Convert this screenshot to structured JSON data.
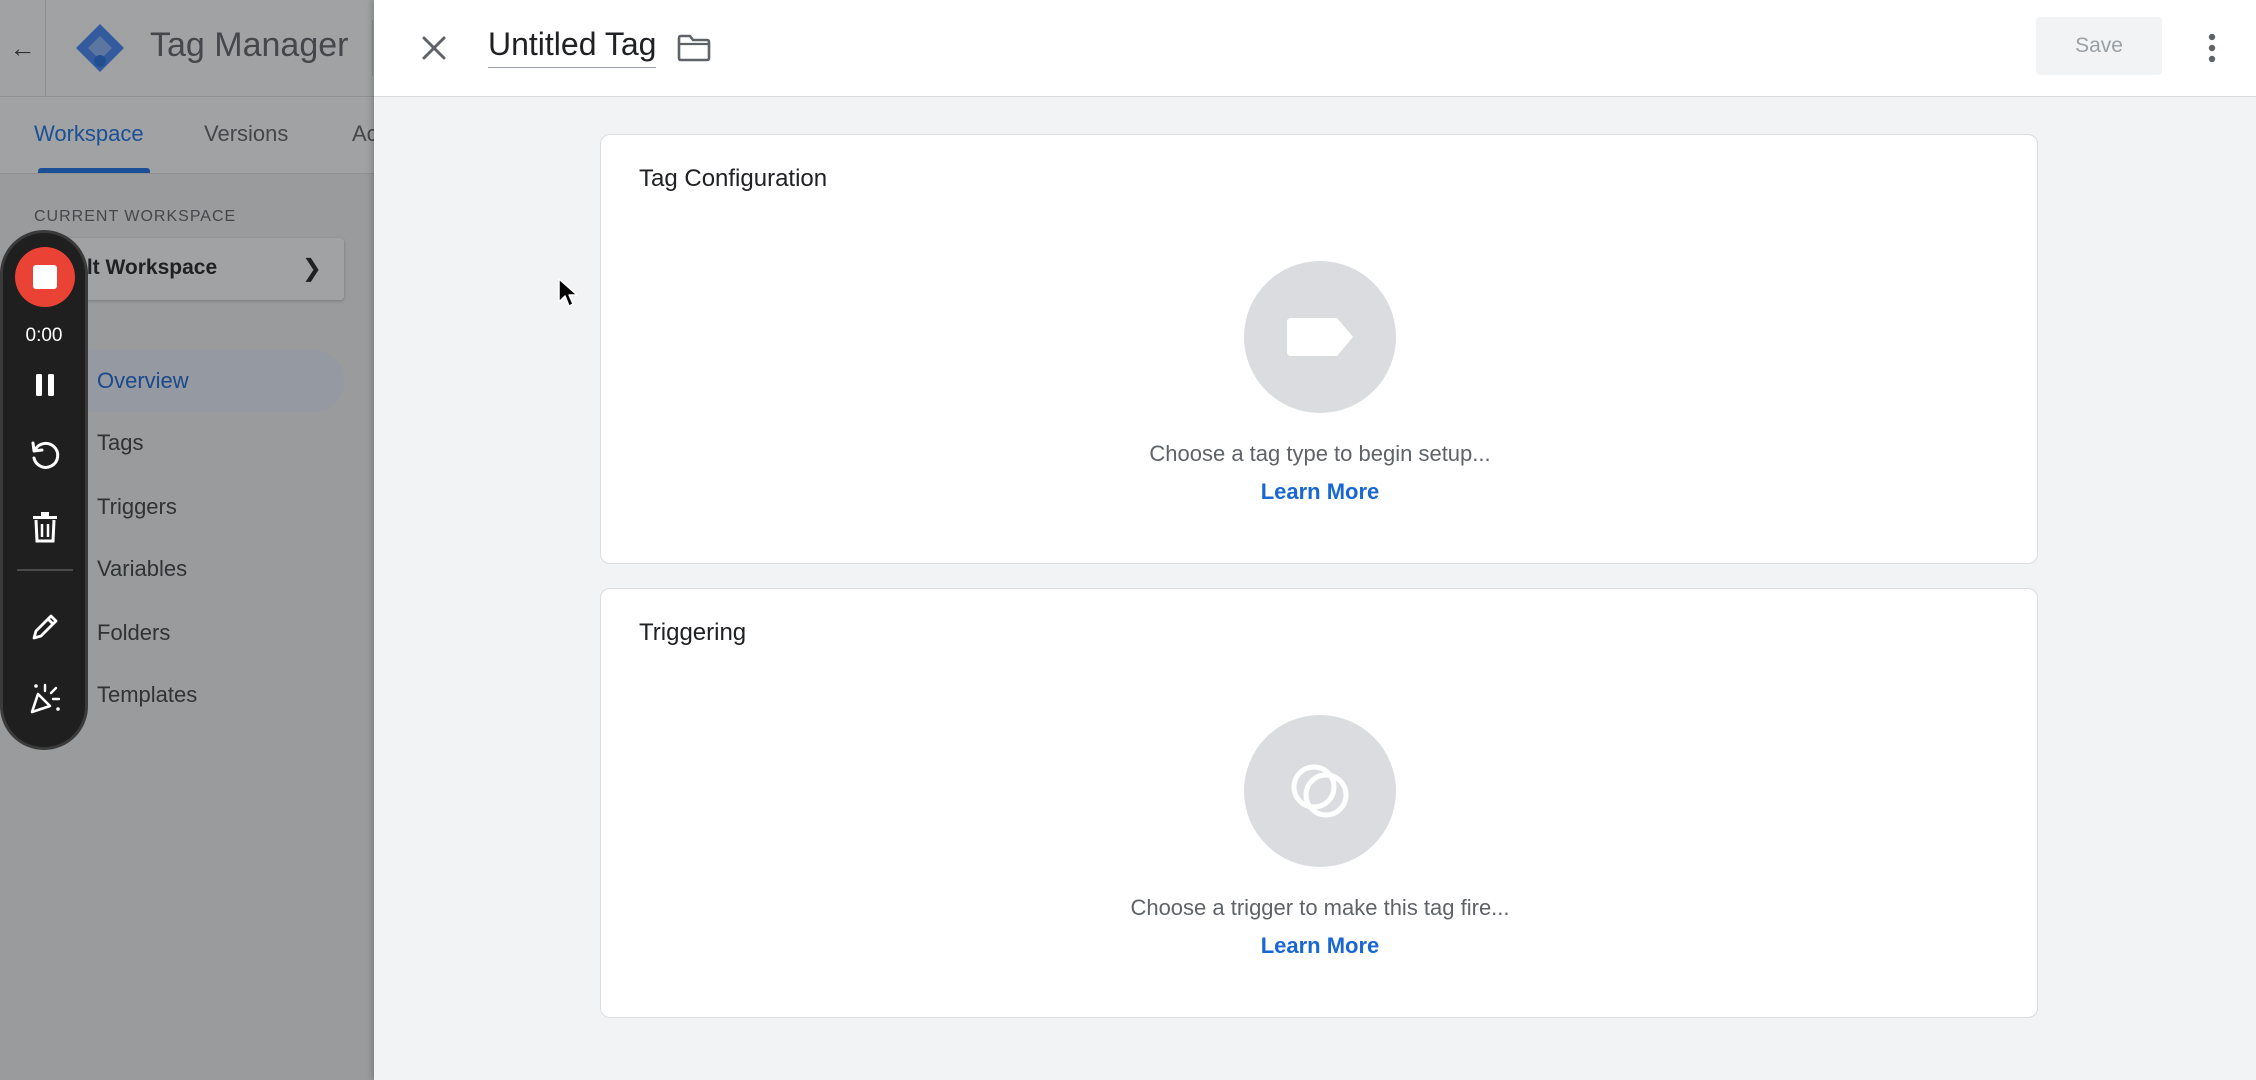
{
  "background_app": {
    "product_name": "Tag Manager",
    "tabs": [
      {
        "label": "Workspace"
      },
      {
        "label": "Versions"
      },
      {
        "label": "Ac"
      }
    ],
    "current_workspace_label": "CURRENT WORKSPACE",
    "workspace_name": "ult Workspace",
    "nav": [
      {
        "label": "Overview"
      },
      {
        "label": "Tags"
      },
      {
        "label": "Triggers"
      },
      {
        "label": "Variables"
      },
      {
        "label": "Folders"
      },
      {
        "label": "Templates"
      }
    ]
  },
  "recorder": {
    "time": "0:00"
  },
  "panel": {
    "title": "Untitled Tag",
    "save_label": "Save",
    "tag_configuration": {
      "title": "Tag Configuration",
      "hint": "Choose a tag type to begin setup...",
      "link": "Learn More"
    },
    "triggering": {
      "title": "Triggering",
      "hint": "Choose a trigger to make this tag fire...",
      "link": "Learn More"
    }
  },
  "colors": {
    "accent": "#1a73e8",
    "link": "#1967d2",
    "record_red": "#ea4335",
    "disabled_text": "#9aa0a6"
  },
  "icons": {
    "close": "close-icon",
    "folder": "folder-icon",
    "more": "more-vert-icon",
    "tag": "tag-icon",
    "trigger": "trigger-icon",
    "stop": "stop-icon",
    "pause": "pause-icon",
    "restart": "restart-icon",
    "delete": "trash-icon",
    "pen": "pen-icon",
    "effects": "effects-icon"
  }
}
